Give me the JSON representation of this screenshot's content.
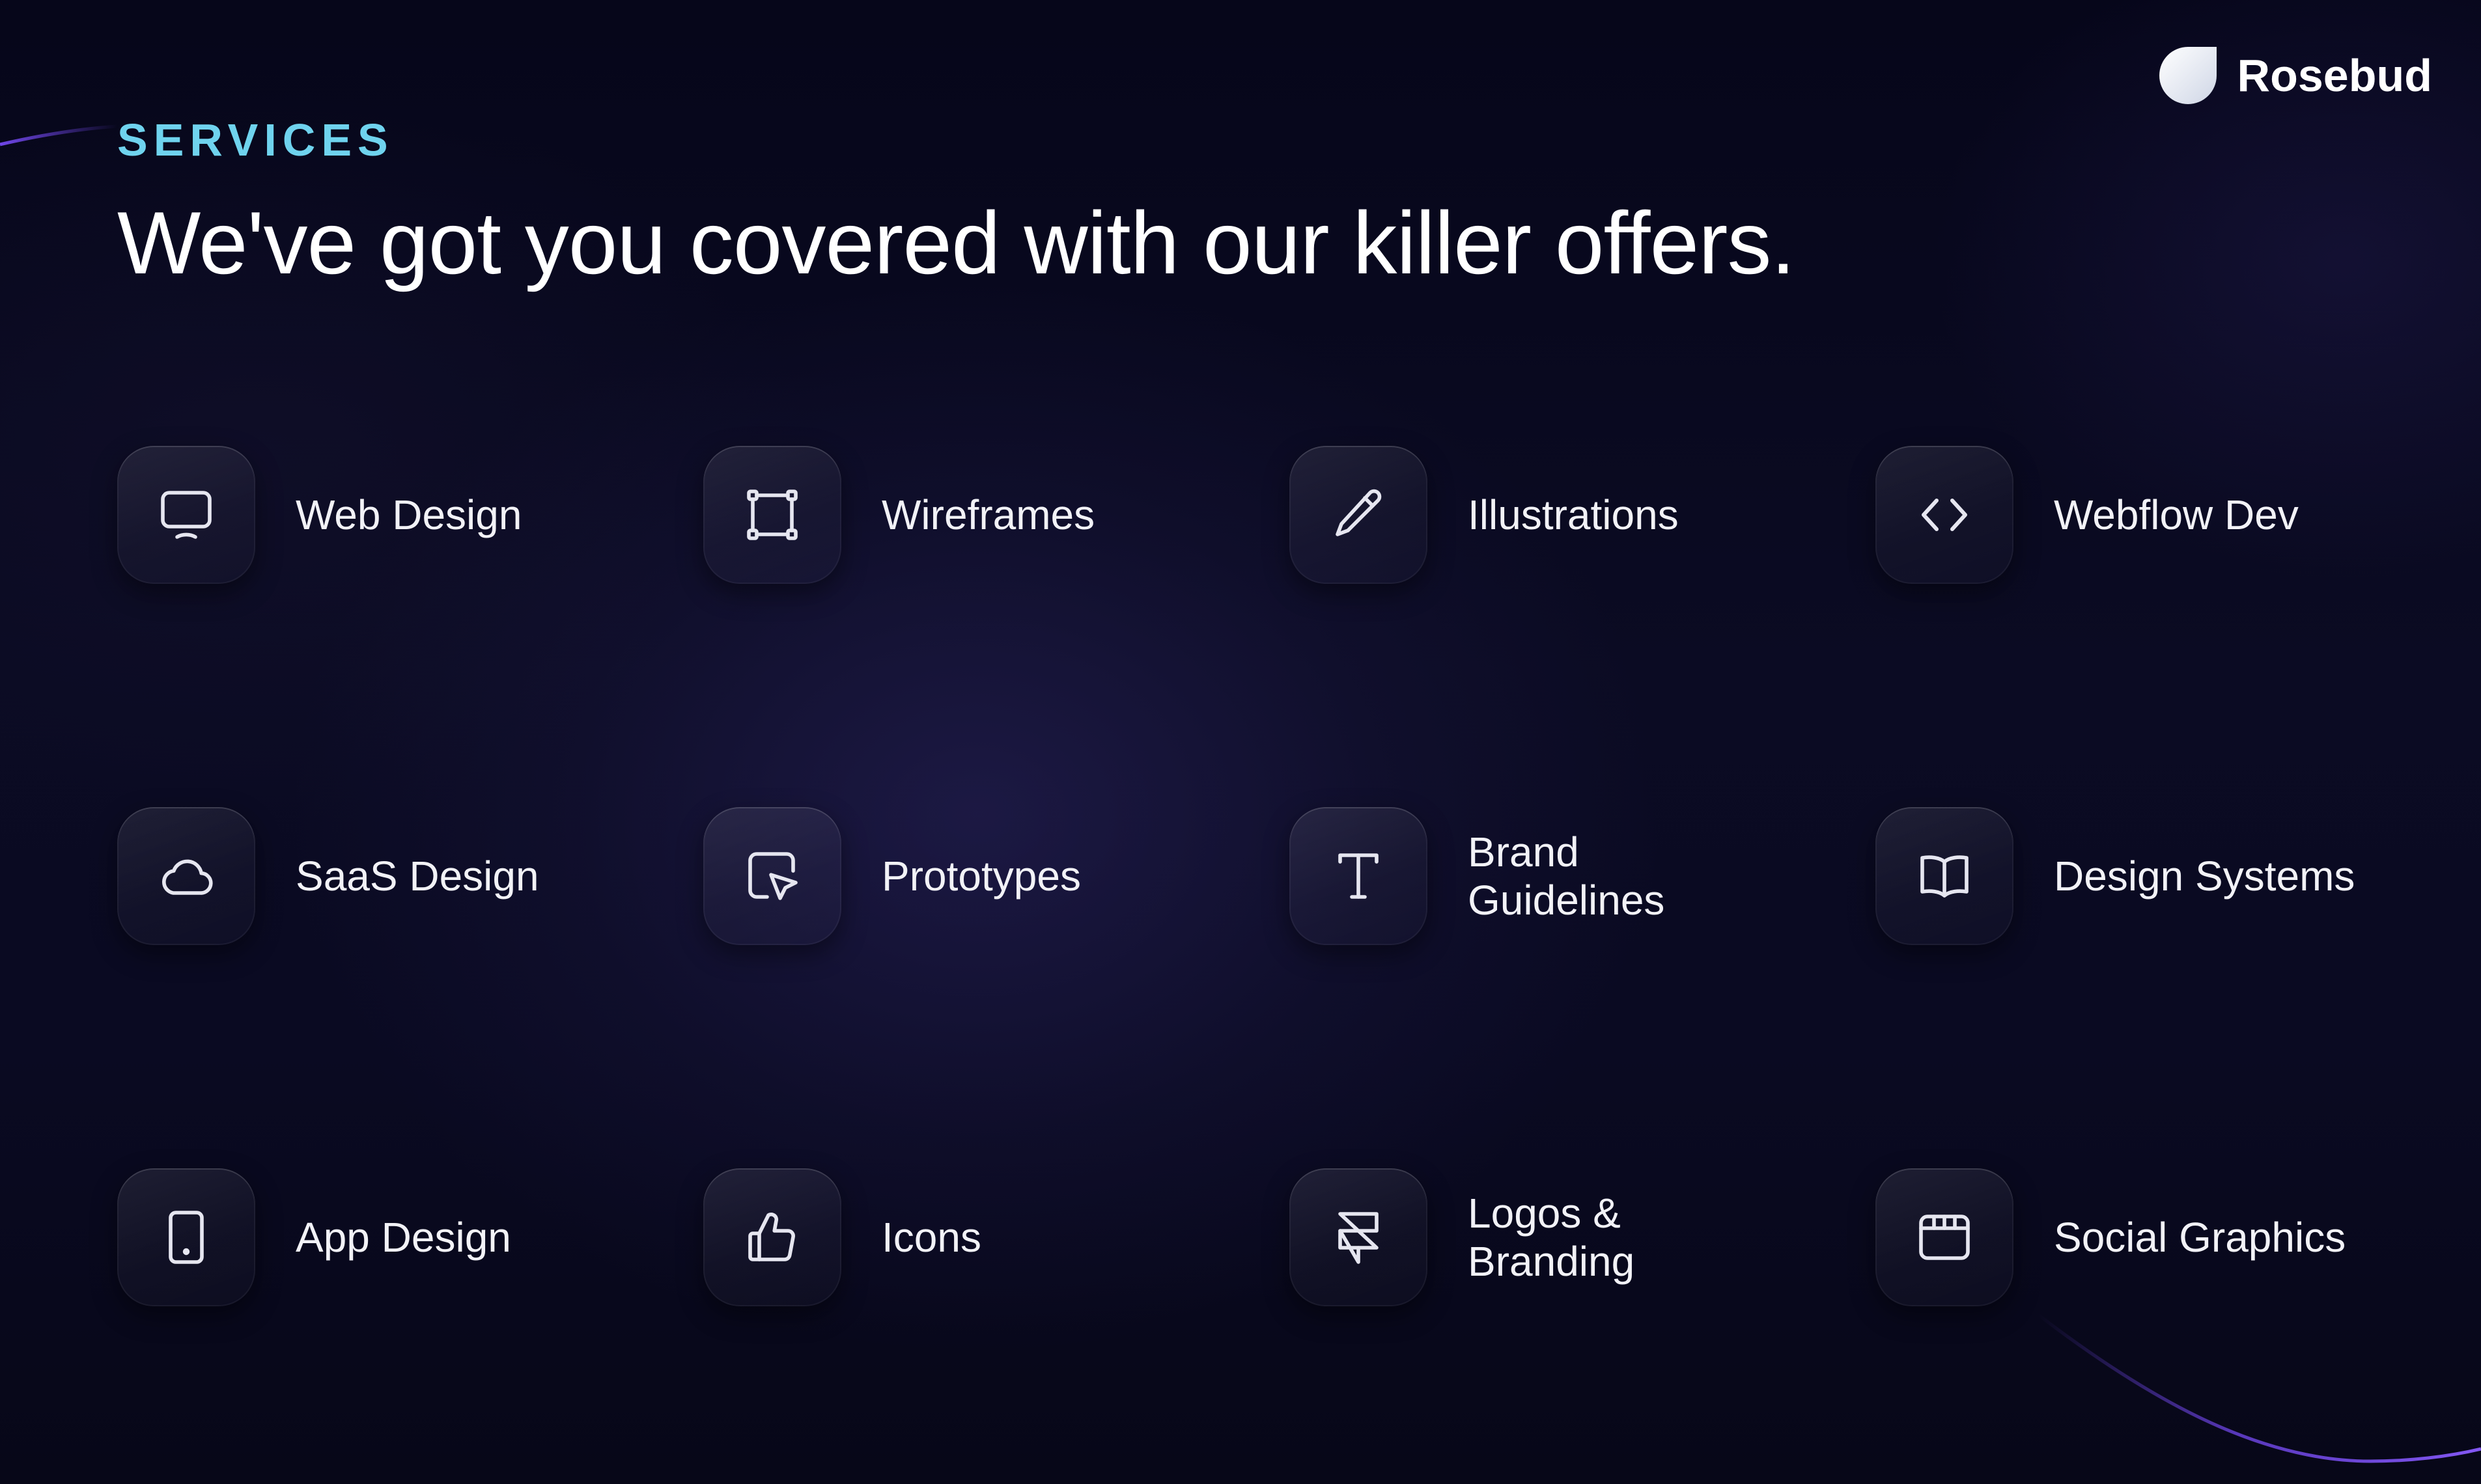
{
  "brand": {
    "name": "Rosebud",
    "logo_icon": "rosebud-drop-logo"
  },
  "header": {
    "eyebrow": "SERVICES",
    "title": "We've got you covered with our killer offers."
  },
  "colors": {
    "accent": "#6fd3ee",
    "background": "#0a0a22",
    "curve": "#7b4dff"
  },
  "services": [
    {
      "label": "Web Design",
      "icon": "monitor-icon"
    },
    {
      "label": "Wireframes",
      "icon": "frame-select-icon"
    },
    {
      "label": "Illustrations",
      "icon": "pencil-icon"
    },
    {
      "label": "Webflow Dev",
      "icon": "code-brackets-icon"
    },
    {
      "label": "SaaS Design",
      "icon": "cloud-icon"
    },
    {
      "label": "Prototypes",
      "icon": "cursor-click-icon"
    },
    {
      "label": "Brand\nGuidelines",
      "icon": "type-letter-icon"
    },
    {
      "label": "Design Systems",
      "icon": "book-open-icon"
    },
    {
      "label": "App Design",
      "icon": "tablet-icon"
    },
    {
      "label": "Icons",
      "icon": "thumbs-up-icon"
    },
    {
      "label": "Logos &\nBranding",
      "icon": "framer-logo-icon"
    },
    {
      "label": "Social Graphics",
      "icon": "browser-window-icon"
    }
  ]
}
